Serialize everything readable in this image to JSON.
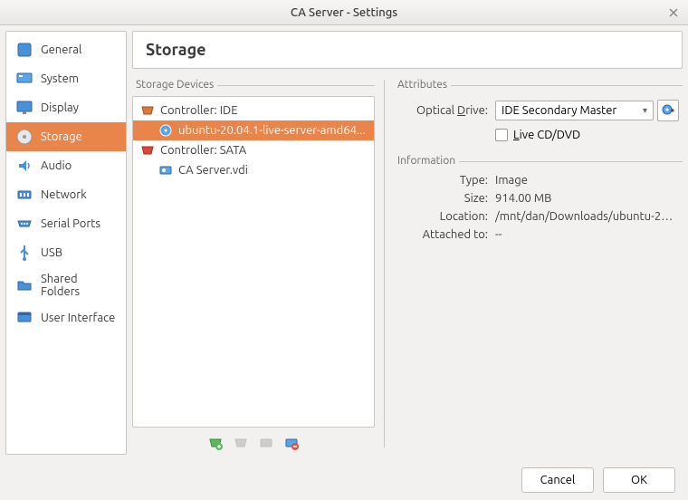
{
  "window": {
    "title": "CA Server - Settings"
  },
  "sidebar": {
    "items": [
      {
        "label": "General"
      },
      {
        "label": "System"
      },
      {
        "label": "Display"
      },
      {
        "label": "Storage"
      },
      {
        "label": "Audio"
      },
      {
        "label": "Network"
      },
      {
        "label": "Serial Ports"
      },
      {
        "label": "USB"
      },
      {
        "label": "Shared Folders"
      },
      {
        "label": "User Interface"
      }
    ]
  },
  "header": {
    "title": "Storage"
  },
  "storage": {
    "devices_label": "Storage Devices",
    "tree": {
      "controller_ide": "Controller: IDE",
      "iso": "ubuntu-20.04.1-live-server-amd64...",
      "controller_sata": "Controller: SATA",
      "vdi": "CA Server.vdi"
    }
  },
  "attributes": {
    "section_label": "Attributes",
    "optical_label_prefix": "Optical ",
    "optical_label_u": "D",
    "optical_label_suffix": "rive:",
    "optical_value": "IDE Secondary Master",
    "live_prefix": "",
    "live_u": "L",
    "live_suffix": "ive CD/DVD"
  },
  "information": {
    "section_label": "Information",
    "rows": {
      "type_label": "Type:",
      "type_value": "Image",
      "size_label": "Size:",
      "size_value": "914.00 MB",
      "location_label": "Location:",
      "location_value": "/mnt/dan/Downloads/ubuntu-20....",
      "attached_label": "Attached to:",
      "attached_value": "--"
    }
  },
  "buttons": {
    "cancel": "Cancel",
    "ok": "OK"
  }
}
